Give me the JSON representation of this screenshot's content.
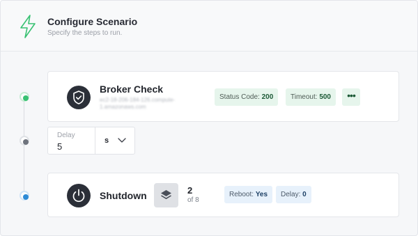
{
  "header": {
    "title": "Configure Scenario",
    "subtitle": "Specify the steps to run.",
    "accent_color": "#38c172",
    "icon": "lightning-bolt-icon"
  },
  "steps": {
    "broker": {
      "name": "Broker Check",
      "host": "ec2-18-206-184-126.compute-1.amazonaws.com",
      "icon": "shield-check-icon",
      "status_color": "#38c172",
      "tags": {
        "status_code_label": "Status Code:",
        "status_code_value": "200",
        "timeout_label": "Timeout:",
        "timeout_value": "500",
        "more": "•••"
      }
    },
    "delay": {
      "label": "Delay",
      "value": "5",
      "unit": "s",
      "status_color": "#6e737d"
    },
    "shutdown": {
      "name": "Shutdown",
      "icon": "power-icon",
      "status_color": "#2d8ad6",
      "layers_icon": "layers-icon",
      "count": "2",
      "of_total": "of 8",
      "tags": {
        "reboot_label": "Reboot:",
        "reboot_value": "Yes",
        "delay_label": "Delay:",
        "delay_value": "0"
      }
    }
  }
}
